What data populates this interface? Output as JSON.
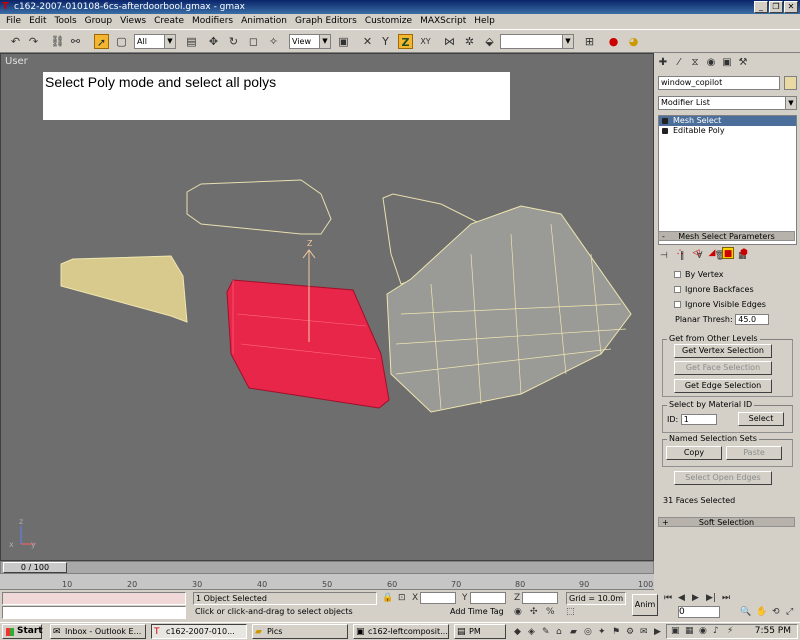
{
  "window": {
    "title": "c162-2007-010108-6cs-afterdoorbool.gmax - gmax",
    "minimize": "_",
    "restore": "❐",
    "close": "✕"
  },
  "menu": [
    "File",
    "Edit",
    "Tools",
    "Group",
    "Views",
    "Create",
    "Modifiers",
    "Animation",
    "Graph Editors",
    "Customize",
    "MAXScript",
    "Help"
  ],
  "toolbar": {
    "selection_filter": "All",
    "reference_coord": "View",
    "axis_z": "Z",
    "axis_xy": "XY",
    "named_selection": ""
  },
  "viewport": {
    "label": "User",
    "instruction": "Select Poly mode and select all polys",
    "gizmo_axis": "Z",
    "axis_x": "x",
    "axis_y": "y",
    "axis_z": "z"
  },
  "command_panel": {
    "object_name": "window_copilot",
    "modifier_list": "Modifier List",
    "stack": [
      "Mesh Select",
      "Editable Poly"
    ],
    "rollout_title": "Mesh Select Parameters",
    "rollout_sign": "-",
    "checks": {
      "by_vertex": "By Vertex",
      "ignore_backfaces": "Ignore Backfaces",
      "ignore_visible_edges": "Ignore Visible Edges"
    },
    "planar_thresh_label": "Planar Thresh:",
    "planar_thresh_value": "45.0",
    "get_from_other_levels": "Get from Other Levels",
    "get_vertex": "Get Vertex Selection",
    "get_face": "Get Face Selection",
    "get_edge": "Get Edge Selection",
    "select_by_material": "Select by Material ID",
    "id_label": "ID:",
    "id_value": "1",
    "select_button": "Select",
    "named_sets": "Named Selection Sets",
    "copy": "Copy",
    "paste": "Paste",
    "select_open_edges": "Select Open Edges",
    "faces_selected": "31 Faces Selected",
    "soft_selection": "Soft Selection",
    "soft_sign": "+"
  },
  "timeline": {
    "frame": "0 / 100",
    "ticks": [
      "10",
      "20",
      "30",
      "40",
      "50",
      "60",
      "70",
      "80",
      "90",
      "100"
    ]
  },
  "status": {
    "objects_selected": "1 Object Selected",
    "prompt": "Click or click-and-drag to select objects",
    "x_label": "X",
    "y_label": "Y",
    "z_label": "Z",
    "grid": "Grid = 10.0m",
    "add_time_tag": "Add Time Tag",
    "anim": "Anim",
    "frame_field": "0"
  },
  "taskbar": {
    "start": "Start",
    "tasks": [
      "Inbox - Outlook E...",
      "c162-2007-010...",
      "Pics",
      "c162-leftcomposit...",
      "PM"
    ],
    "clock": "7:55 PM"
  },
  "colors": {
    "viewport_bg": "#6e6e6e",
    "selected_poly": "#e8264a",
    "mesh_fill": "#d8ca8c",
    "wire": "#f0e6b0",
    "active_tool": "#f2b631"
  }
}
